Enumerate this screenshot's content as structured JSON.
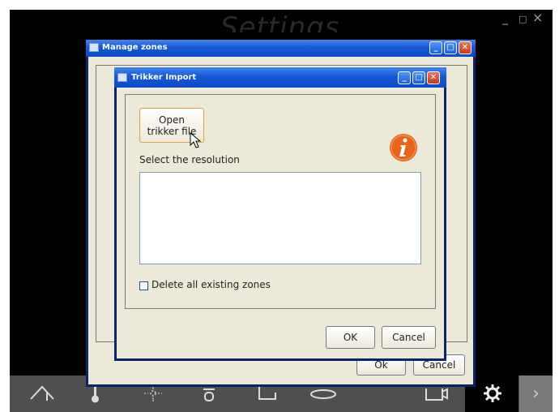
{
  "app": {
    "title": "Settings",
    "window_controls": {
      "minimize": "_",
      "maximize": "□",
      "close": "×"
    }
  },
  "manage_zones": {
    "title": "Manage zones",
    "ok_label": "Ok",
    "cancel_label": "Cancel"
  },
  "import_dialog": {
    "title": "Trikker Import",
    "open_button_line1": "Open",
    "open_button_line2": "trikker file",
    "select_label": "Select the resolution",
    "delete_checkbox_label": "Delete all existing zones",
    "delete_checked": false,
    "ok_label": "OK",
    "cancel_label": "Cancel"
  },
  "toolbar": {
    "icons": [
      "home-icon",
      "thermometer-icon",
      "light-icon",
      "shutter-icon",
      "door-icon",
      "oval-icon",
      "camera-icon",
      "gear-icon",
      "next-icon"
    ],
    "next_glyph": "›"
  },
  "colors": {
    "xp_title": "#1658d6",
    "dialog_bg": "#ece9d8",
    "info_icon": "#e8651b",
    "app_bg": "#000000"
  }
}
